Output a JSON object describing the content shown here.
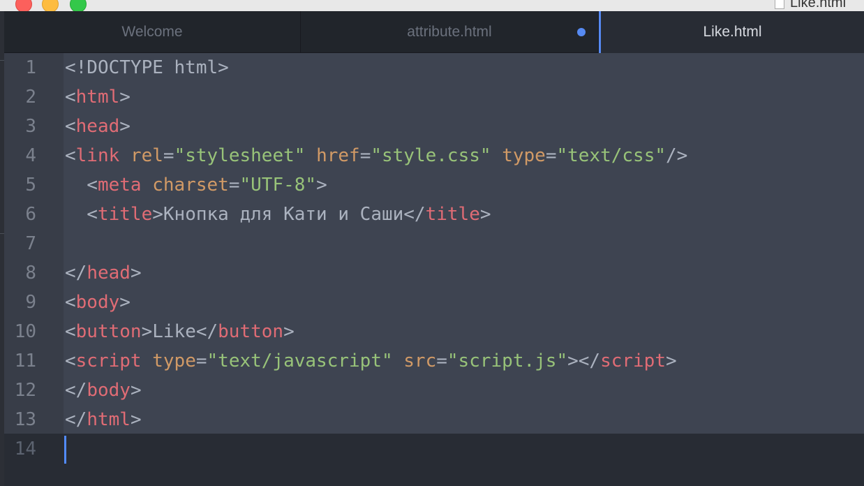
{
  "window": {
    "title": "Like.html"
  },
  "tabs": [
    {
      "label": "Welcome",
      "active": false,
      "modified": false
    },
    {
      "label": "attribute.html",
      "active": false,
      "modified": true
    },
    {
      "label": "Like.html",
      "active": true,
      "modified": false
    }
  ],
  "colors": {
    "tag": "#e06c75",
    "attribute": "#d19a66",
    "string": "#98c379",
    "punctuation": "#abb2bf",
    "accent": "#568af2"
  },
  "editor": {
    "lines": [
      {
        "number": "1",
        "tokens": [
          {
            "t": "p",
            "v": "<!DOCTYPE html>"
          }
        ]
      },
      {
        "number": "2",
        "tokens": [
          {
            "t": "p",
            "v": "<"
          },
          {
            "t": "tg",
            "v": "html"
          },
          {
            "t": "p",
            "v": ">"
          }
        ]
      },
      {
        "number": "3",
        "tokens": [
          {
            "t": "p",
            "v": "<"
          },
          {
            "t": "tg",
            "v": "head"
          },
          {
            "t": "p",
            "v": ">"
          }
        ]
      },
      {
        "number": "4",
        "tokens": [
          {
            "t": "p",
            "v": "<"
          },
          {
            "t": "tg",
            "v": "link"
          },
          {
            "t": "p",
            "v": " "
          },
          {
            "t": "at",
            "v": "rel"
          },
          {
            "t": "p",
            "v": "="
          },
          {
            "t": "st",
            "v": "\"stylesheet\""
          },
          {
            "t": "p",
            "v": " "
          },
          {
            "t": "at",
            "v": "href"
          },
          {
            "t": "p",
            "v": "="
          },
          {
            "t": "st",
            "v": "\"style.css\""
          },
          {
            "t": "p",
            "v": " "
          },
          {
            "t": "at",
            "v": "type"
          },
          {
            "t": "p",
            "v": "="
          },
          {
            "t": "st",
            "v": "\"text/css\""
          },
          {
            "t": "p",
            "v": "/>"
          }
        ]
      },
      {
        "number": "5",
        "tokens": [
          {
            "t": "p",
            "v": "  <"
          },
          {
            "t": "tg",
            "v": "meta"
          },
          {
            "t": "p",
            "v": " "
          },
          {
            "t": "at",
            "v": "charset"
          },
          {
            "t": "p",
            "v": "="
          },
          {
            "t": "st",
            "v": "\"UTF-8\""
          },
          {
            "t": "p",
            "v": ">"
          }
        ]
      },
      {
        "number": "6",
        "tokens": [
          {
            "t": "p",
            "v": "  <"
          },
          {
            "t": "tg",
            "v": "title"
          },
          {
            "t": "p",
            "v": ">Кнопка для Кати и Саши</"
          },
          {
            "t": "tg",
            "v": "title"
          },
          {
            "t": "p",
            "v": ">"
          }
        ]
      },
      {
        "number": "7",
        "tokens": []
      },
      {
        "number": "8",
        "tokens": [
          {
            "t": "p",
            "v": "</"
          },
          {
            "t": "tg",
            "v": "head"
          },
          {
            "t": "p",
            "v": ">"
          }
        ]
      },
      {
        "number": "9",
        "tokens": [
          {
            "t": "p",
            "v": "<"
          },
          {
            "t": "tg",
            "v": "body"
          },
          {
            "t": "p",
            "v": ">"
          }
        ]
      },
      {
        "number": "10",
        "tokens": [
          {
            "t": "p",
            "v": "<"
          },
          {
            "t": "tg",
            "v": "button"
          },
          {
            "t": "p",
            "v": ">Like</"
          },
          {
            "t": "tg",
            "v": "button"
          },
          {
            "t": "p",
            "v": ">"
          }
        ]
      },
      {
        "number": "11",
        "tokens": [
          {
            "t": "p",
            "v": "<"
          },
          {
            "t": "tg",
            "v": "script"
          },
          {
            "t": "p",
            "v": " "
          },
          {
            "t": "at",
            "v": "type"
          },
          {
            "t": "p",
            "v": "="
          },
          {
            "t": "st",
            "v": "\"text/javascript\""
          },
          {
            "t": "p",
            "v": " "
          },
          {
            "t": "at",
            "v": "src"
          },
          {
            "t": "p",
            "v": "="
          },
          {
            "t": "st",
            "v": "\"script.js\""
          },
          {
            "t": "p",
            "v": "></"
          },
          {
            "t": "tg",
            "v": "script"
          },
          {
            "t": "p",
            "v": ">"
          }
        ]
      },
      {
        "number": "12",
        "tokens": [
          {
            "t": "p",
            "v": "</"
          },
          {
            "t": "tg",
            "v": "body"
          },
          {
            "t": "p",
            "v": ">"
          }
        ]
      },
      {
        "number": "13",
        "tokens": [
          {
            "t": "p",
            "v": "</"
          },
          {
            "t": "tg",
            "v": "html"
          },
          {
            "t": "p",
            "v": ">"
          }
        ]
      },
      {
        "number": "14",
        "tokens": []
      }
    ]
  }
}
